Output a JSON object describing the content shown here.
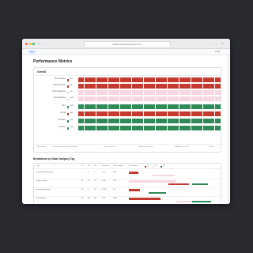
{
  "browser": {
    "url": "claude-https-staging.anthropic.com"
  },
  "header": {
    "badge": "Runs",
    "right_text": "10:18"
  },
  "page": {
    "title": "Performance Metrics"
  },
  "overall": {
    "title": "Overall",
    "rows": [
      {
        "label": "True Positives",
        "value": "479",
        "color": "#c53a2e"
      },
      {
        "label": "False Positives",
        "value": "389",
        "color": "#c53a2e"
      },
      {
        "label": "False Negatives",
        "value": "100",
        "color": "#f7d6df"
      },
      {
        "label": "True Negatives",
        "value": "1198",
        "color": "#f7d6df"
      },
      {
        "label": "F0.5",
        "value": "0.58",
        "color": "#2f8a57"
      },
      {
        "label": "Recall",
        "value": "0.83",
        "color": "#c53a2e"
      },
      {
        "label": "Precision",
        "value": "0.55",
        "color": "#2f8a57"
      },
      {
        "label": "F1 score",
        "value": "0.66",
        "color": "#2f8a57"
      }
    ],
    "footer": [
      "464 Samples",
      "Sensitivity applied to: 0.45 threshold",
      "Filter to review: 1, 2",
      "Total requested: 2400",
      "Validation errors: 104"
    ],
    "footer_right": "Details"
  },
  "breakdown": {
    "title": "Breakdown by Data Category Tag",
    "columns": [
      "Tag",
      "TP",
      "FP",
      "FN",
      "Precision",
      "Total samples",
      "Distribution"
    ],
    "legend": [
      "TP",
      "FP",
      "FN"
    ],
    "rows": [
      {
        "tag": "unsafe-authentication",
        "tp": "1",
        "fp": "5",
        "fn": "7",
        "precision": "0.17",
        "total": "0.20"
      },
      {
        "tag": "open-account",
        "tp": "41",
        "fp": "22",
        "fn": "74",
        "precision": "0.65",
        "total": "0.70"
      },
      {
        "tag": "user-authorization",
        "tp": "11",
        "fp": "6",
        "fn": "17",
        "precision": "0.718",
        "total": "0.5"
      },
      {
        "tag": "user-balance",
        "tp": "26",
        "fp": "98",
        "fn": "46",
        "precision": "0.21",
        "total": "0.647"
      }
    ]
  },
  "colors": {
    "red": "#c53a2e",
    "pink": "#f7d6df",
    "green": "#2f8a57",
    "background": "#292b30"
  }
}
